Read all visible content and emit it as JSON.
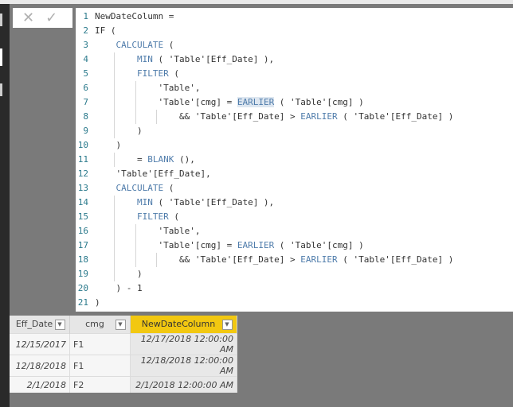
{
  "formula_bar": {
    "cancel_icon": "x-icon",
    "commit_icon": "check-icon",
    "lines": [
      {
        "indent": 0,
        "tokens": [
          {
            "t": "NewDateColumn =",
            "k": "txt"
          }
        ]
      },
      {
        "indent": 0,
        "tokens": [
          {
            "t": "IF (",
            "k": "txt"
          }
        ]
      },
      {
        "indent": 4,
        "tokens": [
          {
            "t": "CALCULATE",
            "k": "fn"
          },
          {
            "t": " (",
            "k": "txt"
          }
        ]
      },
      {
        "indent": 8,
        "tokens": [
          {
            "t": "MIN",
            "k": "fn"
          },
          {
            "t": " ( 'Table'[Eff_Date] ),",
            "k": "txt"
          }
        ]
      },
      {
        "indent": 8,
        "tokens": [
          {
            "t": "FILTER",
            "k": "fn"
          },
          {
            "t": " (",
            "k": "txt"
          }
        ]
      },
      {
        "indent": 12,
        "tokens": [
          {
            "t": "'Table',",
            "k": "txt"
          }
        ]
      },
      {
        "indent": 12,
        "tokens": [
          {
            "t": "'Table'[cmg] = ",
            "k": "txt"
          },
          {
            "t": "EARLIER",
            "k": "fn hl"
          },
          {
            "t": " ( 'Table'[cmg] )",
            "k": "txt"
          }
        ]
      },
      {
        "indent": 16,
        "tokens": [
          {
            "t": "&& 'Table'[Eff_Date] > ",
            "k": "txt"
          },
          {
            "t": "EARLIER",
            "k": "fn"
          },
          {
            "t": " ( 'Table'[Eff_Date] )",
            "k": "txt"
          }
        ]
      },
      {
        "indent": 8,
        "tokens": [
          {
            "t": ")",
            "k": "txt"
          }
        ]
      },
      {
        "indent": 4,
        "tokens": [
          {
            "t": ")",
            "k": "txt"
          }
        ]
      },
      {
        "indent": 8,
        "tokens": [
          {
            "t": "= ",
            "k": "txt"
          },
          {
            "t": "BLANK",
            "k": "fn"
          },
          {
            "t": " (),",
            "k": "txt"
          }
        ]
      },
      {
        "indent": 4,
        "tokens": [
          {
            "t": "'Table'[Eff_Date],",
            "k": "txt"
          }
        ]
      },
      {
        "indent": 4,
        "tokens": [
          {
            "t": "CALCULATE",
            "k": "fn"
          },
          {
            "t": " (",
            "k": "txt"
          }
        ]
      },
      {
        "indent": 8,
        "tokens": [
          {
            "t": "MIN",
            "k": "fn"
          },
          {
            "t": " ( 'Table'[Eff_Date] ),",
            "k": "txt"
          }
        ]
      },
      {
        "indent": 8,
        "tokens": [
          {
            "t": "FILTER",
            "k": "fn"
          },
          {
            "t": " (",
            "k": "txt"
          }
        ]
      },
      {
        "indent": 12,
        "tokens": [
          {
            "t": "'Table',",
            "k": "txt"
          }
        ]
      },
      {
        "indent": 12,
        "tokens": [
          {
            "t": "'Table'[cmg] = ",
            "k": "txt"
          },
          {
            "t": "EARLIER",
            "k": "fn"
          },
          {
            "t": " ( 'Table'[cmg] )",
            "k": "txt"
          }
        ]
      },
      {
        "indent": 16,
        "tokens": [
          {
            "t": "&& 'Table'[Eff_Date] > ",
            "k": "txt"
          },
          {
            "t": "EARLIER",
            "k": "fn"
          },
          {
            "t": " ( 'Table'[Eff_Date] )",
            "k": "txt"
          }
        ]
      },
      {
        "indent": 8,
        "tokens": [
          {
            "t": ")",
            "k": "txt"
          }
        ]
      },
      {
        "indent": 4,
        "tokens": [
          {
            "t": ") - 1",
            "k": "txt"
          }
        ]
      },
      {
        "indent": 0,
        "tokens": [
          {
            "t": ")",
            "k": "txt"
          }
        ]
      }
    ]
  },
  "table": {
    "columns": [
      "Eff_Date",
      "cmg",
      "NewDateColumn"
    ],
    "selected_column": "NewDateColumn",
    "rows": [
      [
        "12/15/2017",
        "F1",
        "12/17/2018 12:00:00 AM"
      ],
      [
        "12/18/2018",
        "F1",
        "12/18/2018 12:00:00 AM"
      ],
      [
        "2/1/2018",
        "F2",
        "2/1/2018 12:00:00 AM"
      ]
    ]
  },
  "colors": {
    "accent": "#f2c811",
    "keyword": "#4f7cab",
    "line_number": "#2b7a8c"
  }
}
